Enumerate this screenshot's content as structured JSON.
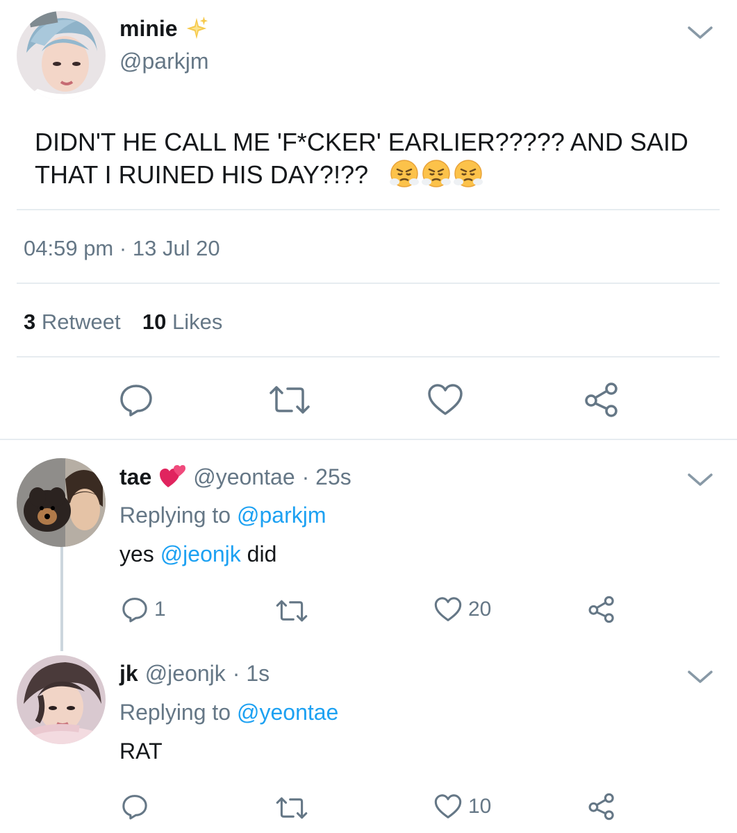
{
  "main_tweet": {
    "display_name": "minie",
    "name_emoji": "sparkles-icon",
    "handle": "@parkjm",
    "text_line1": "DIDN'T HE CALL ME 'F*CKER' EARLIER????? AND SAID",
    "text_line2": "THAT I RUINED HIS DAY?!??",
    "text_emojis": [
      "face-with-steam-icon",
      "face-with-steam-icon",
      "face-with-steam-icon"
    ],
    "time": "04:59 pm",
    "separator": "·",
    "date": "13 Jul 20",
    "retweet_count": "3",
    "retweet_label": "Retweet",
    "like_count": "10",
    "like_label": "Likes"
  },
  "replies": [
    {
      "display_name": "tae",
      "name_emoji": "revolving-hearts-icon",
      "handle": "@yeontae",
      "age": "· 25s",
      "replying_label": "Replying to",
      "replying_to": "@parkjm",
      "text_before": "yes",
      "text_mention": "@jeonjk",
      "text_after": "did",
      "reply_count": "1",
      "retweet_count": "",
      "like_count": "20"
    },
    {
      "display_name": "jk",
      "handle": "@jeonjk",
      "age": "· 1s",
      "replying_label": "Replying to",
      "replying_to": "@yeontae",
      "text": "RAT",
      "reply_count": "",
      "retweet_count": "",
      "like_count": "10"
    }
  ],
  "colors": {
    "text": "#14171a",
    "secondary": "#657786",
    "link": "#1da1f2",
    "divider": "#e6ecf0"
  }
}
